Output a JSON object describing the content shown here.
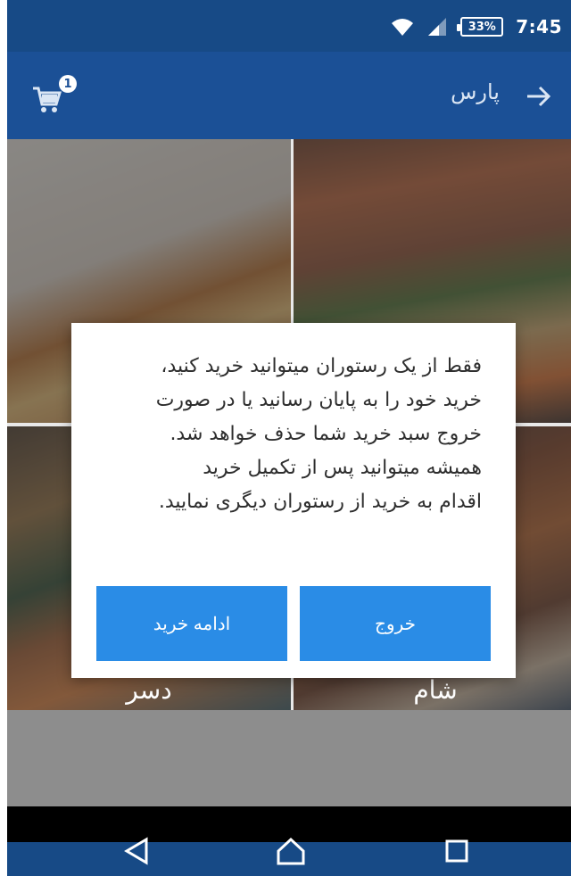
{
  "status_bar": {
    "battery": "33%",
    "time": "7:45"
  },
  "app_bar": {
    "title": "پارس",
    "cart_count": "1"
  },
  "tiles": [
    {
      "label": ""
    },
    {
      "label": ""
    },
    {
      "label": "دسر"
    },
    {
      "label": "شام"
    }
  ],
  "dialog": {
    "lines": [
      "فقط از یک رستوران میتوانید خرید کنید،",
      "خرید خود را به پایان رسانید یا در صورت",
      "خروج سبد خرید شما حذف خواهد شد.",
      "همیشه میتوانید پس از تکمیل خرید",
      "اقدام به خرید از رستوران دیگری نمایید."
    ],
    "exit_label": "خروج",
    "continue_label": "ادامه خرید"
  },
  "colors": {
    "status_bar": "#174a86",
    "app_bar": "#1b5096",
    "button": "#2a8ce6"
  },
  "icons": {
    "status": [
      "wifi-icon",
      "signal-icon",
      "battery-icon"
    ],
    "app_bar": [
      "back-arrow-icon",
      "cart-icon"
    ],
    "nav": [
      "nav-back-icon",
      "nav-home-icon",
      "nav-recents-icon"
    ]
  }
}
